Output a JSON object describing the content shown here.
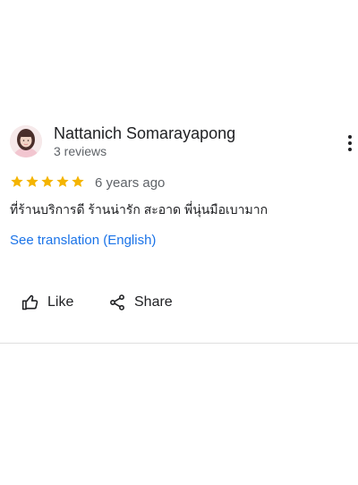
{
  "review": {
    "author_name": "Nattanich Somarayapong",
    "author_review_count": "3 reviews",
    "rating": 5,
    "rating_max": 5,
    "time_ago": "6 years ago",
    "text": "ที่ร้านบริการดี ร้านน่ารัก สะอาด พี่นุ่นมือเบามาก",
    "translate_link": "See translation (English)"
  },
  "actions": {
    "like_label": "Like",
    "share_label": "Share"
  },
  "colors": {
    "star": "#f4b400",
    "link": "#1a73e8",
    "secondary_text": "#5f6368",
    "divider": "#e0e0e0"
  }
}
